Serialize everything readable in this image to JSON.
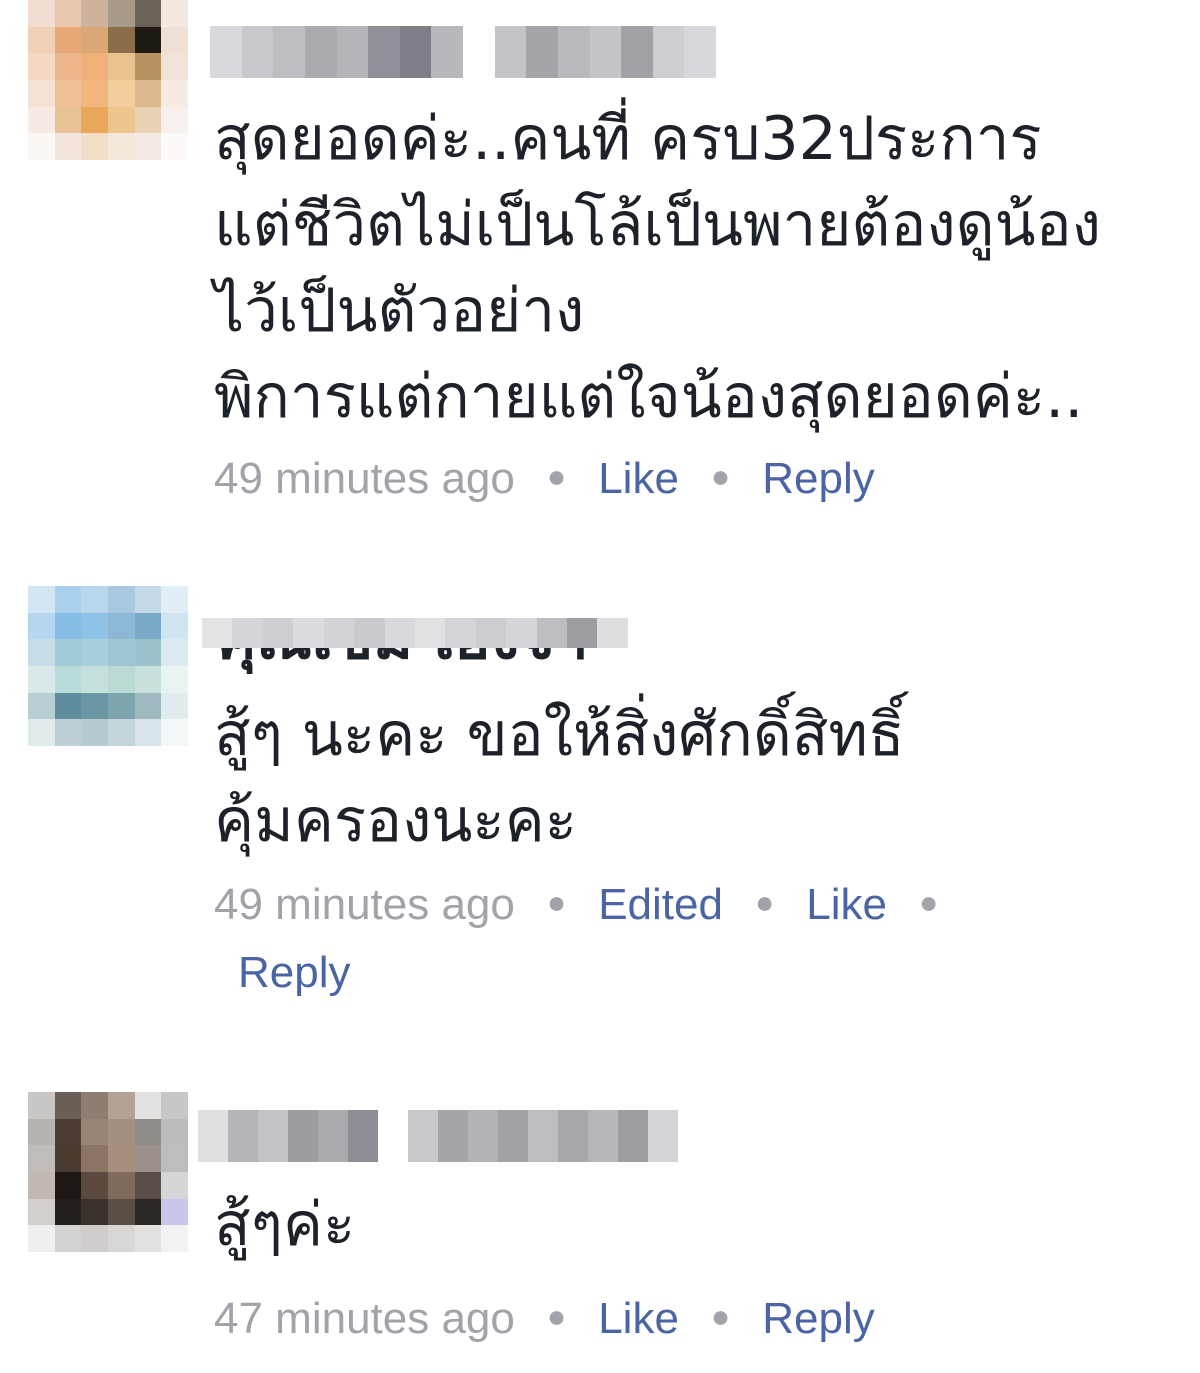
{
  "comments": [
    {
      "body": "สุดยอดค่ะ..คนที่ ครบ32ประการ\nแต่ชีวิตไม่เป็นโล้เป็นพายต้องดูน้อง\nไว้เป็นตัวอย่าง\nพิการแต่กายแต่ใจน้องสุดยอดค่ะ..",
      "time": "49 minutes ago",
      "like_label": "Like",
      "reply_label": "Reply"
    },
    {
      "name_partial": "คุณเข็ม เองจ้า",
      "body": "สู้ๆ นะคะ ขอให้สิ่งศักดิ์สิทธิ์\nคุ้มครองนะคะ",
      "time": "49 minutes ago",
      "edited_label": "Edited",
      "like_label": "Like",
      "reply_label": "Reply"
    },
    {
      "body": "สู้ๆค่ะ",
      "time": "47 minutes ago",
      "like_label": "Like",
      "reply_label": "Reply"
    }
  ],
  "colors": {
    "text": "#1d2129",
    "meta": "#a0a3a9",
    "action": "#4b64a3"
  },
  "icons": [
    "blurred-avatar",
    "separator-dot"
  ]
}
